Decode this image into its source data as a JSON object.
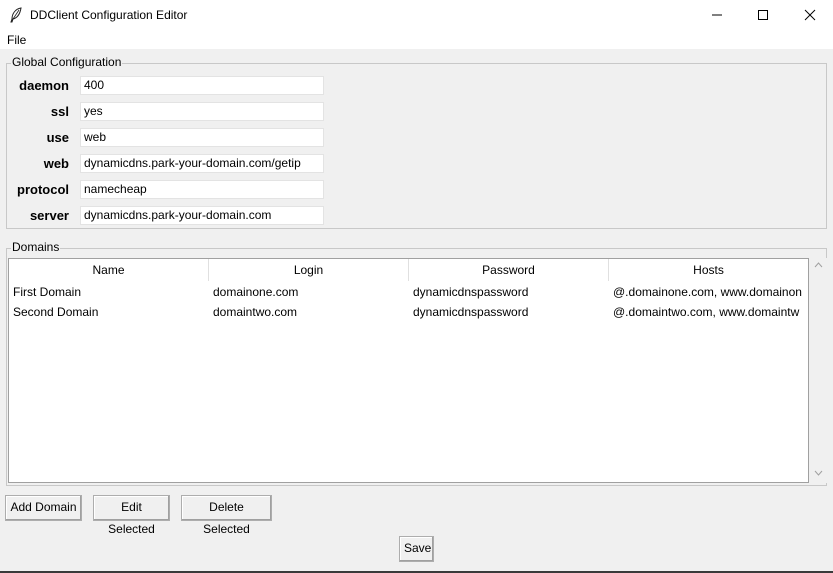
{
  "window": {
    "title": "DDClient Configuration Editor",
    "icon": "feather-icon"
  },
  "menu": {
    "file": "File"
  },
  "global": {
    "legend": "Global Configuration",
    "fields": [
      {
        "label": "daemon",
        "value": "400"
      },
      {
        "label": "ssl",
        "value": "yes"
      },
      {
        "label": "use",
        "value": "web"
      },
      {
        "label": "web",
        "value": "dynamicdns.park-your-domain.com/getip"
      },
      {
        "label": "protocol",
        "value": "namecheap"
      },
      {
        "label": "server",
        "value": "dynamicdns.park-your-domain.com"
      }
    ]
  },
  "domains": {
    "legend": "Domains",
    "columns": [
      "Name",
      "Login",
      "Password",
      "Hosts"
    ],
    "rows": [
      [
        "First Domain",
        "domainone.com",
        "dynamicdnspassword",
        "@.domainone.com, www.domainon"
      ],
      [
        "Second Domain",
        "domaintwo.com",
        "dynamicdnspassword",
        "@.domaintwo.com, www.domaintw"
      ]
    ]
  },
  "buttons": {
    "add": "Add Domain",
    "edit": "Edit Selected",
    "delete": "Delete Selected",
    "save": "Save"
  }
}
